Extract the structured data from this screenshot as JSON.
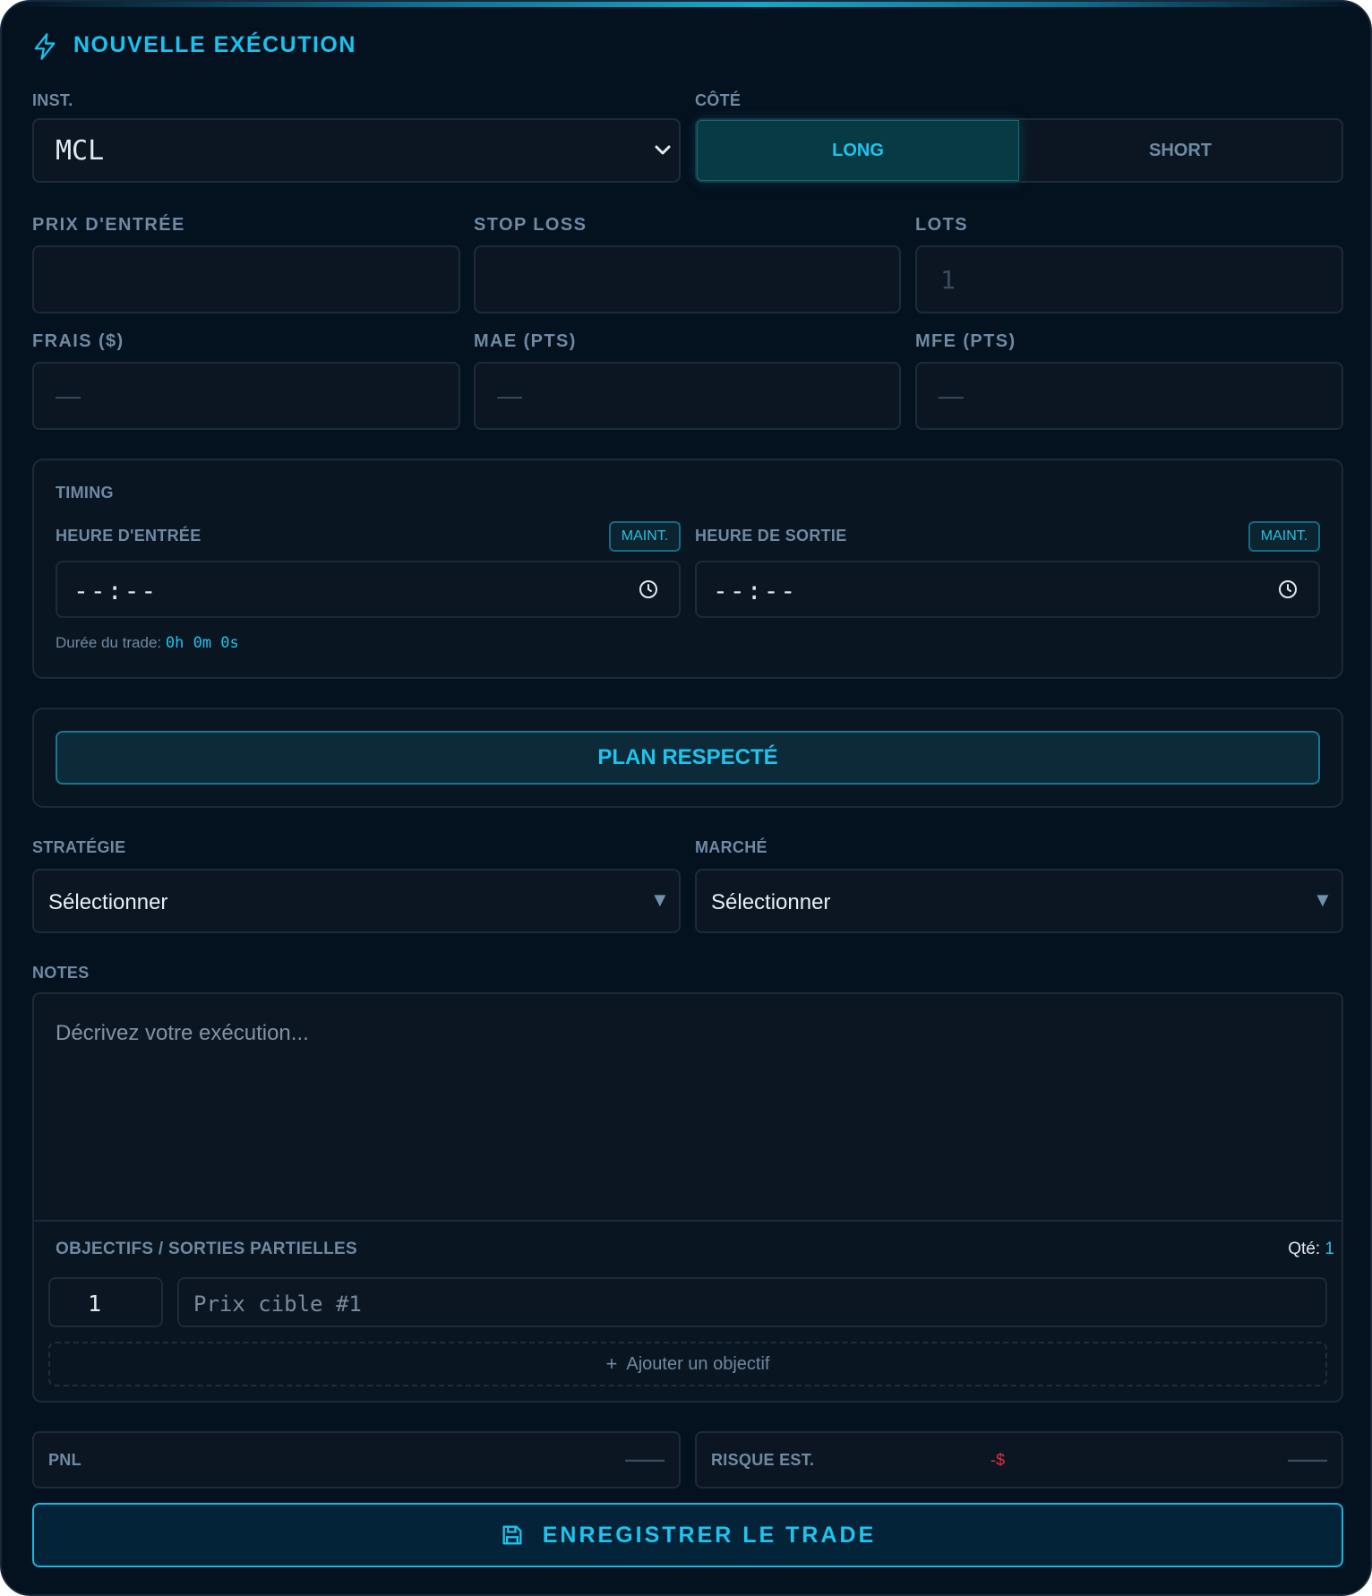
{
  "form": {
    "title": "NOUVELLE EXÉCUTION",
    "instrument": {
      "label": "INST.",
      "value": "MCL"
    },
    "side": {
      "label": "CÔTÉ",
      "long": "LONG",
      "short": "SHORT"
    },
    "entry_price": {
      "label": "PRIX D'ENTRÉE",
      "value": ""
    },
    "stop_loss": {
      "label": "STOP LOSS",
      "value": ""
    },
    "lots": {
      "label": "LOTS",
      "placeholder": "1"
    },
    "fees": {
      "label": "FRAIS ($)",
      "placeholder": "—"
    },
    "mae": {
      "label": "MAE (PTS)",
      "placeholder": "—"
    },
    "mfe": {
      "label": "MFE (PTS)",
      "placeholder": "—"
    },
    "timing": {
      "title": "TIMING",
      "entry": {
        "label": "HEURE D'ENTRÉE",
        "value": "--:--",
        "now": "MAINT."
      },
      "exit": {
        "label": "HEURE DE SORTIE",
        "value": "--:--",
        "now": "MAINT."
      },
      "duration_label": "Durée du trade:",
      "duration_value": "0h 0m 0s"
    },
    "plan_button": "PLAN RESPECTÉ",
    "strategy": {
      "label": "STRATÉGIE",
      "value": "Sélectionner"
    },
    "market": {
      "label": "MARCHÉ",
      "value": "Sélectionner"
    },
    "notes": {
      "label": "NOTES",
      "placeholder": "Décrivez votre exécution..."
    },
    "targets": {
      "title": "OBJECTIFS / SORTIES PARTIELLES",
      "qty_label": "Qté:",
      "qty_value": "1",
      "rows": [
        {
          "qty": "1",
          "price_placeholder": "Prix cible #1"
        }
      ],
      "add_label": "Ajouter un objectif"
    },
    "pnl": {
      "label": "PNL",
      "value": "——"
    },
    "risk": {
      "label": "RISQUE EST.",
      "amount": "-$",
      "value": "——"
    },
    "save_button": "ENREGISTRER LE TRADE"
  },
  "colors": {
    "accent": "#19c3ee",
    "danger": "#e0313a",
    "background": "#04111f"
  }
}
